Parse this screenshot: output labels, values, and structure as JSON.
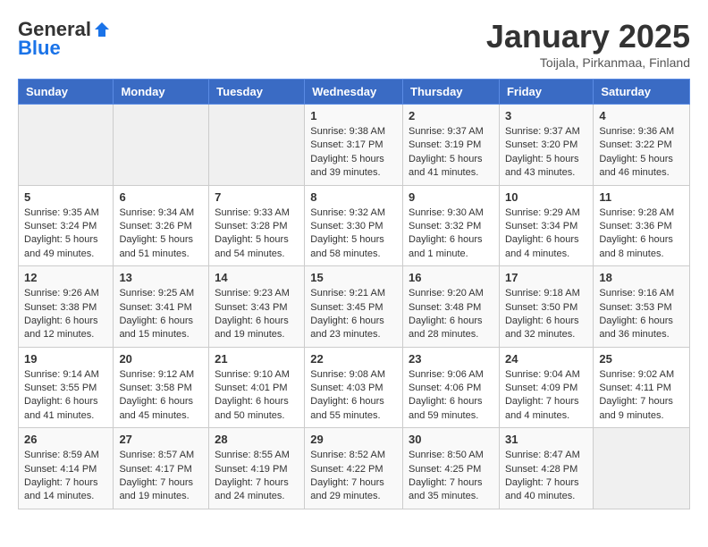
{
  "header": {
    "logo_general": "General",
    "logo_blue": "Blue",
    "title": "January 2025",
    "subtitle": "Toijala, Pirkanmaa, Finland"
  },
  "weekdays": [
    "Sunday",
    "Monday",
    "Tuesday",
    "Wednesday",
    "Thursday",
    "Friday",
    "Saturday"
  ],
  "rows": [
    [
      {
        "day": "",
        "sunrise": "",
        "sunset": "",
        "daylight": ""
      },
      {
        "day": "",
        "sunrise": "",
        "sunset": "",
        "daylight": ""
      },
      {
        "day": "",
        "sunrise": "",
        "sunset": "",
        "daylight": ""
      },
      {
        "day": "1",
        "sunrise": "Sunrise: 9:38 AM",
        "sunset": "Sunset: 3:17 PM",
        "daylight": "Daylight: 5 hours and 39 minutes."
      },
      {
        "day": "2",
        "sunrise": "Sunrise: 9:37 AM",
        "sunset": "Sunset: 3:19 PM",
        "daylight": "Daylight: 5 hours and 41 minutes."
      },
      {
        "day": "3",
        "sunrise": "Sunrise: 9:37 AM",
        "sunset": "Sunset: 3:20 PM",
        "daylight": "Daylight: 5 hours and 43 minutes."
      },
      {
        "day": "4",
        "sunrise": "Sunrise: 9:36 AM",
        "sunset": "Sunset: 3:22 PM",
        "daylight": "Daylight: 5 hours and 46 minutes."
      }
    ],
    [
      {
        "day": "5",
        "sunrise": "Sunrise: 9:35 AM",
        "sunset": "Sunset: 3:24 PM",
        "daylight": "Daylight: 5 hours and 49 minutes."
      },
      {
        "day": "6",
        "sunrise": "Sunrise: 9:34 AM",
        "sunset": "Sunset: 3:26 PM",
        "daylight": "Daylight: 5 hours and 51 minutes."
      },
      {
        "day": "7",
        "sunrise": "Sunrise: 9:33 AM",
        "sunset": "Sunset: 3:28 PM",
        "daylight": "Daylight: 5 hours and 54 minutes."
      },
      {
        "day": "8",
        "sunrise": "Sunrise: 9:32 AM",
        "sunset": "Sunset: 3:30 PM",
        "daylight": "Daylight: 5 hours and 58 minutes."
      },
      {
        "day": "9",
        "sunrise": "Sunrise: 9:30 AM",
        "sunset": "Sunset: 3:32 PM",
        "daylight": "Daylight: 6 hours and 1 minute."
      },
      {
        "day": "10",
        "sunrise": "Sunrise: 9:29 AM",
        "sunset": "Sunset: 3:34 PM",
        "daylight": "Daylight: 6 hours and 4 minutes."
      },
      {
        "day": "11",
        "sunrise": "Sunrise: 9:28 AM",
        "sunset": "Sunset: 3:36 PM",
        "daylight": "Daylight: 6 hours and 8 minutes."
      }
    ],
    [
      {
        "day": "12",
        "sunrise": "Sunrise: 9:26 AM",
        "sunset": "Sunset: 3:38 PM",
        "daylight": "Daylight: 6 hours and 12 minutes."
      },
      {
        "day": "13",
        "sunrise": "Sunrise: 9:25 AM",
        "sunset": "Sunset: 3:41 PM",
        "daylight": "Daylight: 6 hours and 15 minutes."
      },
      {
        "day": "14",
        "sunrise": "Sunrise: 9:23 AM",
        "sunset": "Sunset: 3:43 PM",
        "daylight": "Daylight: 6 hours and 19 minutes."
      },
      {
        "day": "15",
        "sunrise": "Sunrise: 9:21 AM",
        "sunset": "Sunset: 3:45 PM",
        "daylight": "Daylight: 6 hours and 23 minutes."
      },
      {
        "day": "16",
        "sunrise": "Sunrise: 9:20 AM",
        "sunset": "Sunset: 3:48 PM",
        "daylight": "Daylight: 6 hours and 28 minutes."
      },
      {
        "day": "17",
        "sunrise": "Sunrise: 9:18 AM",
        "sunset": "Sunset: 3:50 PM",
        "daylight": "Daylight: 6 hours and 32 minutes."
      },
      {
        "day": "18",
        "sunrise": "Sunrise: 9:16 AM",
        "sunset": "Sunset: 3:53 PM",
        "daylight": "Daylight: 6 hours and 36 minutes."
      }
    ],
    [
      {
        "day": "19",
        "sunrise": "Sunrise: 9:14 AM",
        "sunset": "Sunset: 3:55 PM",
        "daylight": "Daylight: 6 hours and 41 minutes."
      },
      {
        "day": "20",
        "sunrise": "Sunrise: 9:12 AM",
        "sunset": "Sunset: 3:58 PM",
        "daylight": "Daylight: 6 hours and 45 minutes."
      },
      {
        "day": "21",
        "sunrise": "Sunrise: 9:10 AM",
        "sunset": "Sunset: 4:01 PM",
        "daylight": "Daylight: 6 hours and 50 minutes."
      },
      {
        "day": "22",
        "sunrise": "Sunrise: 9:08 AM",
        "sunset": "Sunset: 4:03 PM",
        "daylight": "Daylight: 6 hours and 55 minutes."
      },
      {
        "day": "23",
        "sunrise": "Sunrise: 9:06 AM",
        "sunset": "Sunset: 4:06 PM",
        "daylight": "Daylight: 6 hours and 59 minutes."
      },
      {
        "day": "24",
        "sunrise": "Sunrise: 9:04 AM",
        "sunset": "Sunset: 4:09 PM",
        "daylight": "Daylight: 7 hours and 4 minutes."
      },
      {
        "day": "25",
        "sunrise": "Sunrise: 9:02 AM",
        "sunset": "Sunset: 4:11 PM",
        "daylight": "Daylight: 7 hours and 9 minutes."
      }
    ],
    [
      {
        "day": "26",
        "sunrise": "Sunrise: 8:59 AM",
        "sunset": "Sunset: 4:14 PM",
        "daylight": "Daylight: 7 hours and 14 minutes."
      },
      {
        "day": "27",
        "sunrise": "Sunrise: 8:57 AM",
        "sunset": "Sunset: 4:17 PM",
        "daylight": "Daylight: 7 hours and 19 minutes."
      },
      {
        "day": "28",
        "sunrise": "Sunrise: 8:55 AM",
        "sunset": "Sunset: 4:19 PM",
        "daylight": "Daylight: 7 hours and 24 minutes."
      },
      {
        "day": "29",
        "sunrise": "Sunrise: 8:52 AM",
        "sunset": "Sunset: 4:22 PM",
        "daylight": "Daylight: 7 hours and 29 minutes."
      },
      {
        "day": "30",
        "sunrise": "Sunrise: 8:50 AM",
        "sunset": "Sunset: 4:25 PM",
        "daylight": "Daylight: 7 hours and 35 minutes."
      },
      {
        "day": "31",
        "sunrise": "Sunrise: 8:47 AM",
        "sunset": "Sunset: 4:28 PM",
        "daylight": "Daylight: 7 hours and 40 minutes."
      },
      {
        "day": "",
        "sunrise": "",
        "sunset": "",
        "daylight": ""
      }
    ]
  ]
}
